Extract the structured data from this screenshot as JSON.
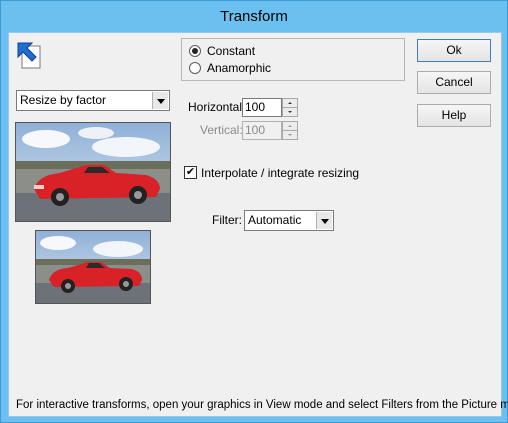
{
  "window": {
    "title": "Transform"
  },
  "mode": {
    "selected": "Resize by factor",
    "options": [
      {
        "label": "Constant",
        "checked": true
      },
      {
        "label": "Anamorphic",
        "checked": false
      }
    ]
  },
  "resize": {
    "horizontal_label": "Horizontal:",
    "horizontal_value": "100",
    "vertical_label": "Vertical:",
    "vertical_value": "100"
  },
  "interpolate": {
    "label": "Interpolate / integrate resizing",
    "checked": true
  },
  "filter": {
    "label": "Filter:",
    "selected": "Automatic"
  },
  "buttons": {
    "ok": "Ok",
    "cancel": "Cancel",
    "help": "Help"
  },
  "footer_text": "For interactive transforms, open your graphics in View mode and select Filters from the Picture menu.",
  "colors": {
    "titlebar": "#6cc0f0",
    "car": "#d82228",
    "sky": "#b8cde6"
  },
  "icons": [
    "cursor-arrow-icon",
    "checkmark-icon",
    "dropdown-arrow-icon"
  ]
}
